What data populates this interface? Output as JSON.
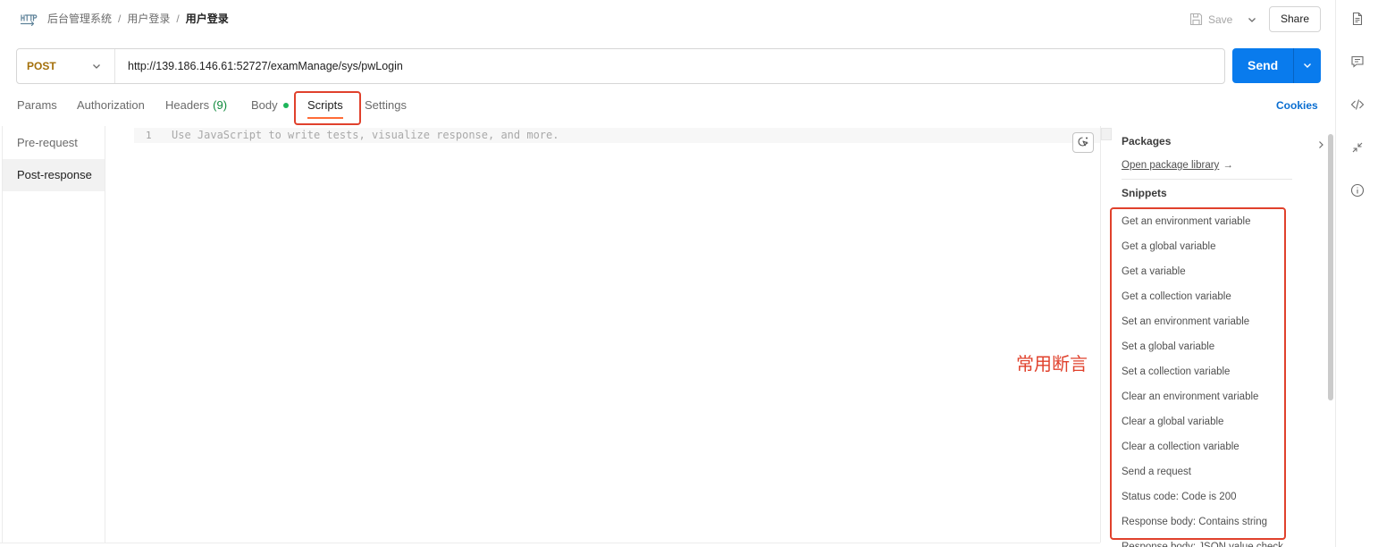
{
  "header": {
    "breadcrumb": {
      "collection": "后台管理系统",
      "folder": "用户登录",
      "separator": "/",
      "request": "用户登录"
    },
    "save_label": "Save",
    "share_label": "Share"
  },
  "request": {
    "method": "POST",
    "url": "http://139.186.146.61:52727/examManage/sys/pwLogin",
    "send_label": "Send"
  },
  "tabs": {
    "items": [
      {
        "label": "Params"
      },
      {
        "label": "Authorization"
      },
      {
        "label": "Headers",
        "count": "(9)"
      },
      {
        "label": "Body",
        "indicator_dot": true
      },
      {
        "label": "Scripts",
        "active": true
      },
      {
        "label": "Settings"
      }
    ],
    "cookies_label": "Cookies"
  },
  "scripts": {
    "phases": [
      {
        "label": "Pre-request",
        "selected": false
      },
      {
        "label": "Post-response",
        "selected": true
      }
    ],
    "editor": {
      "line_number": "1",
      "placeholder": "Use JavaScript to write tests, visualize response, and more."
    }
  },
  "side_panel": {
    "packages_title": "Packages",
    "package_link": "Open package library",
    "package_link_arrow": "→",
    "snippets_title": "Snippets",
    "snippets": [
      "Get an environment variable",
      "Get a global variable",
      "Get a variable",
      "Get a collection variable",
      "Set an environment variable",
      "Set a global variable",
      "Set a collection variable",
      "Clear an environment variable",
      "Clear a global variable",
      "Clear a collection variable",
      "Send a request",
      "Status code: Code is 200",
      "Response body: Contains string",
      "Response body: JSON value check"
    ]
  },
  "annotation": {
    "label": "常用断言"
  },
  "colors": {
    "accent": "#097bed",
    "method_post": "#a4700b",
    "annotation": "#e0412c",
    "tab_active": "#ff6c37",
    "count": "#0f8a3c",
    "dot": "#1db55a",
    "link": "#0a6ed1"
  },
  "icons": {
    "breadcrumb": "http-request-icon",
    "save": "save-icon",
    "save_menu": "chevron-down-icon",
    "method_dropdown": "chevron-down-icon",
    "send_menu": "chevron-down-icon",
    "editor_assist": "postbot-icon",
    "packages_expand": "chevron-right-icon",
    "right_rail": [
      "documentation-icon",
      "comments-icon",
      "code-icon",
      "related-icon",
      "info-icon"
    ]
  }
}
